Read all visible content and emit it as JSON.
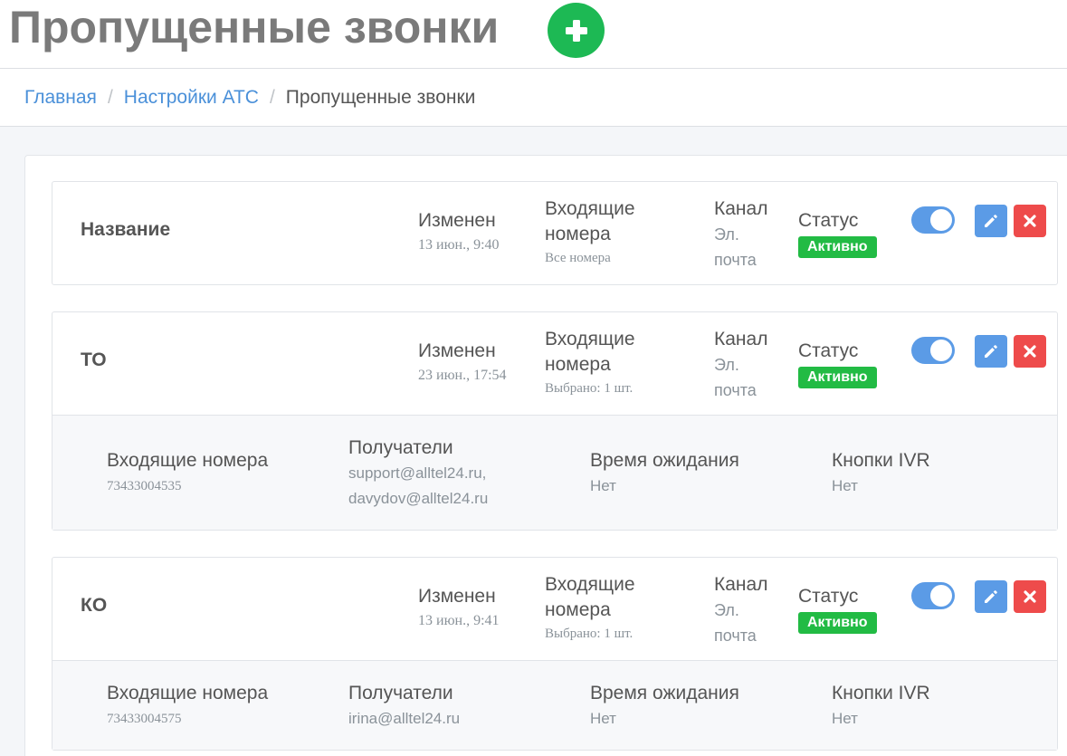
{
  "header": {
    "title": "Пропущенные звонки",
    "add_icon": "plus-icon"
  },
  "breadcrumb": {
    "items": [
      "Главная",
      "Настройки АТС"
    ],
    "current": "Пропущенные звонки"
  },
  "labels": {
    "modified": "Изменен",
    "incoming_1": "Входящие",
    "incoming_2": "номера",
    "channel": "Канал",
    "channel_value_1": "Эл.",
    "channel_value_2": "почта",
    "status": "Статус",
    "status_value": "Активно",
    "det_incoming": "Входящие номера",
    "det_recipients": "Получатели",
    "det_wait": "Время ожидания",
    "det_ivr": "Кнопки IVR"
  },
  "colors": {
    "accent": "#5b9be6",
    "active": "#22bb44",
    "danger": "#ee4b4b",
    "add": "#1db954"
  },
  "cards": [
    {
      "name": "Название",
      "modified": "13 июн., 9:40",
      "incoming": "Все номера",
      "enabled": true
    },
    {
      "name": "ТО",
      "modified": "23 июн., 17:54",
      "incoming": "Выбрано: 1 шт.",
      "enabled": true,
      "details": {
        "incoming": "73433004535",
        "recipients_1": "support@alltel24.ru,",
        "recipients_2": "davydov@alltel24.ru",
        "wait": "Нет",
        "ivr": "Нет"
      }
    },
    {
      "name": "КО",
      "modified": "13 июн., 9:41",
      "incoming": "Выбрано: 1 шт.",
      "enabled": true,
      "details": {
        "incoming": "73433004575",
        "recipients_1": "irina@alltel24.ru",
        "wait": "Нет",
        "ivr": "Нет"
      }
    }
  ]
}
